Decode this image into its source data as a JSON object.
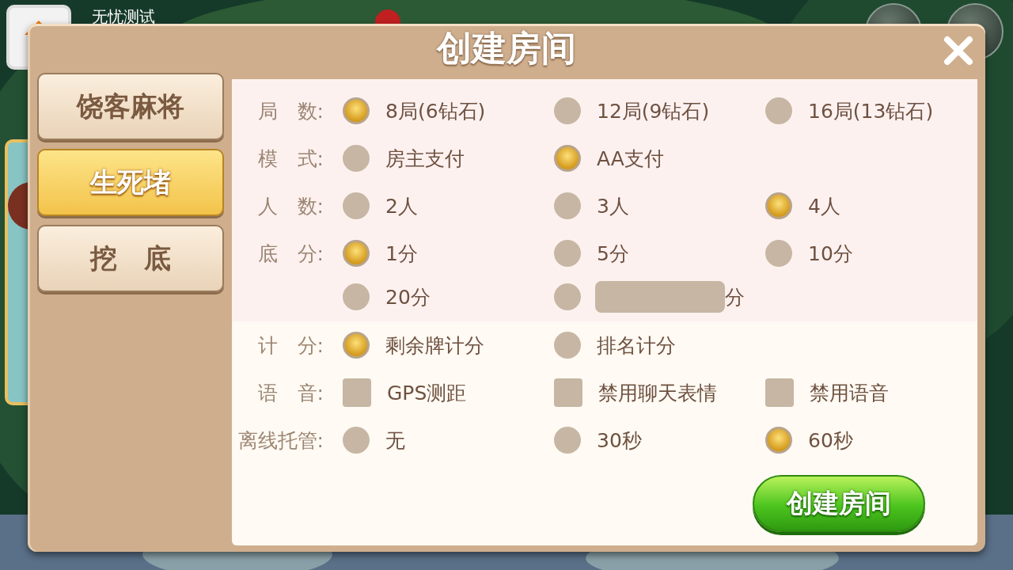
{
  "backdrop": {
    "user_name": "无忧测试"
  },
  "dialog": {
    "title": "创建房间"
  },
  "game_tabs": [
    {
      "label": "饶客麻将",
      "selected": false
    },
    {
      "label": "生死堵",
      "selected": true
    },
    {
      "label": "挖　底",
      "selected": false
    }
  ],
  "rule_sections": [
    {
      "rows": [
        {
          "label": "局　数:",
          "options": [
            {
              "kind": "radio",
              "text": "8局(6钻石)",
              "selected": true
            },
            {
              "kind": "radio",
              "text": "12局(9钻石)",
              "selected": false
            },
            {
              "kind": "radio",
              "text": "16局(13钻石)",
              "selected": false
            }
          ]
        },
        {
          "label": "模　式:",
          "options": [
            {
              "kind": "radio",
              "text": "房主支付",
              "selected": false
            },
            {
              "kind": "radio",
              "text": "AA支付",
              "selected": true
            }
          ]
        },
        {
          "label": "人　数:",
          "options": [
            {
              "kind": "radio",
              "text": "2人",
              "selected": false
            },
            {
              "kind": "radio",
              "text": "3人",
              "selected": false
            },
            {
              "kind": "radio",
              "text": "4人",
              "selected": true
            }
          ]
        },
        {
          "label": "底　分:",
          "options": [
            {
              "kind": "radio",
              "text": "1分",
              "selected": true
            },
            {
              "kind": "radio",
              "text": "5分",
              "selected": false
            },
            {
              "kind": "radio",
              "text": "10分",
              "selected": false
            }
          ]
        },
        {
          "options": [
            {
              "kind": "radio",
              "text": "20分",
              "selected": false
            },
            {
              "kind": "input",
              "suffix": "分",
              "selected": false
            }
          ]
        }
      ]
    },
    {
      "rows": [
        {
          "label": "计　分:",
          "options": [
            {
              "kind": "radio",
              "text": "剩余牌计分",
              "selected": true
            },
            {
              "kind": "radio",
              "text": "排名计分",
              "selected": false
            }
          ]
        },
        {
          "label": "语　音:",
          "options": [
            {
              "kind": "checkbox",
              "text": "GPS测距",
              "checked": false
            },
            {
              "kind": "checkbox",
              "text": "禁用聊天表情",
              "checked": false
            },
            {
              "kind": "checkbox",
              "text": "禁用语音",
              "checked": false
            }
          ]
        },
        {
          "label": "离线托管:",
          "options": [
            {
              "kind": "radio",
              "text": "无",
              "selected": false
            },
            {
              "kind": "radio",
              "text": "30秒",
              "selected": false
            },
            {
              "kind": "radio",
              "text": "60秒",
              "selected": true
            }
          ]
        }
      ]
    }
  ],
  "create_button": "创建房间"
}
